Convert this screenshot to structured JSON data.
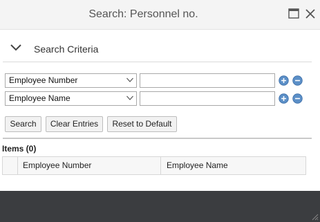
{
  "dialog": {
    "title": "Search: Personnel no."
  },
  "criteria": {
    "label": "Search Criteria",
    "rows": [
      {
        "field": "Employee Number",
        "value": ""
      },
      {
        "field": "Employee Name",
        "value": ""
      }
    ]
  },
  "buttons": {
    "search": "Search",
    "clear": "Clear Entries",
    "reset": "Reset to Default"
  },
  "results": {
    "title": "Items (0)",
    "columns": [
      "Employee Number",
      "Employee Name"
    ]
  },
  "colors": {
    "accent_blue": "#5b8fc7",
    "footer": "#3b3d40"
  },
  "icons": [
    "maximize-icon",
    "close-icon",
    "chevron-down-icon",
    "dropdown-caret-icon",
    "add-icon",
    "remove-icon",
    "resize-grip-icon"
  ]
}
